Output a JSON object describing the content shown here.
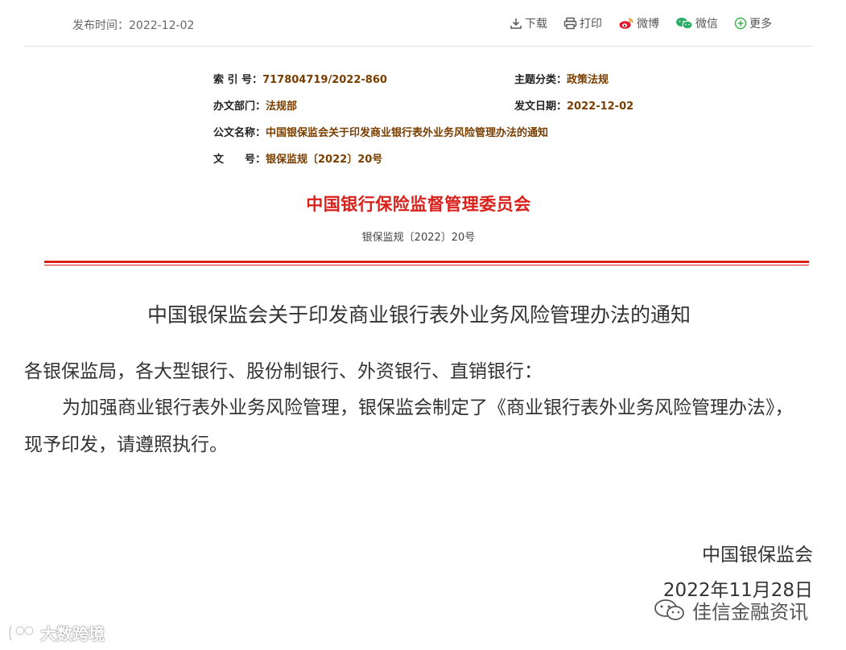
{
  "header": {
    "pubtime": "发布时间：2022-12-02",
    "tools": {
      "download": "下载",
      "print": "打印",
      "weibo": "微博",
      "wechat": "微信",
      "more": "更多"
    }
  },
  "meta": {
    "index_key": "索 引 号：",
    "index_value": "717804719/2022-860",
    "topic_key": "主题分类：",
    "topic_value": "政策法规",
    "dept_key": "办文部门：",
    "dept_value": "法规部",
    "date_key": "发文日期：",
    "date_value": "2022-12-02",
    "name_key": "公文名称：",
    "name_value": "中国银保监会关于印发商业银行表外业务风险管理办法的通知",
    "no_key": "文　　号：",
    "no_value": "银保监规〔2022〕20号"
  },
  "doc": {
    "issuer": "中国银行保险监督管理委员会",
    "doc_number": "银保监规〔2022〕20号",
    "title": "中国银保监会关于印发商业银行表外业务风险管理办法的通知",
    "salutation": "各银保监局，各大型银行、股份制银行、外资银行、直销银行：",
    "body": "为加强商业银行表外业务风险管理，银保监会制定了《商业银行表外业务风险管理办法》，现予印发，请遵照执行。",
    "signer": "中国银保监会",
    "sign_date": "2022年11月28日"
  },
  "watermarks": {
    "left": "大数跨境",
    "right": "佳信金融资讯"
  },
  "colors": {
    "accent_red": "#d9201b",
    "meta_value": "#7a3e00"
  }
}
